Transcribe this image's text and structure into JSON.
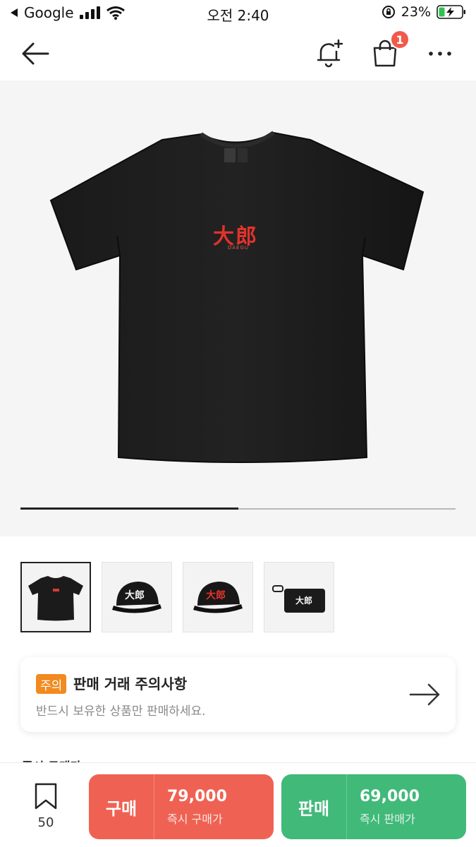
{
  "status_bar": {
    "back_app": "Google",
    "time": "오전 2:40",
    "battery": "23%"
  },
  "nav": {
    "cart_count": "1"
  },
  "product": {
    "shirt_text": "大郎",
    "shirt_subtext": "DAEGU",
    "carousel_progress": 0.5,
    "thumbnail_count": 4
  },
  "notice": {
    "badge": "주의",
    "title": "판매 거래 주의사항",
    "subtitle": "반드시 보유한 상품만 판매하세요."
  },
  "section_peek": "즉시 구매가",
  "bottom": {
    "wish_count": "50",
    "buy": {
      "label": "구매",
      "price": "79,000",
      "sub": "즉시 구매가"
    },
    "sell": {
      "label": "판매",
      "price": "69,000",
      "sub": "즉시 판매가"
    }
  },
  "colors": {
    "buy": "#ef6253",
    "sell": "#41b979",
    "notice_badge": "#f28a1f",
    "cart_badge": "#ef5b4b"
  },
  "icons": [
    "back-triangle-icon",
    "signal-icon",
    "wifi-icon",
    "rotation-lock-icon",
    "battery-icon",
    "back-arrow-icon",
    "bell-plus-icon",
    "shopping-bag-icon",
    "more-icon",
    "arrow-right-icon",
    "bookmark-icon"
  ]
}
